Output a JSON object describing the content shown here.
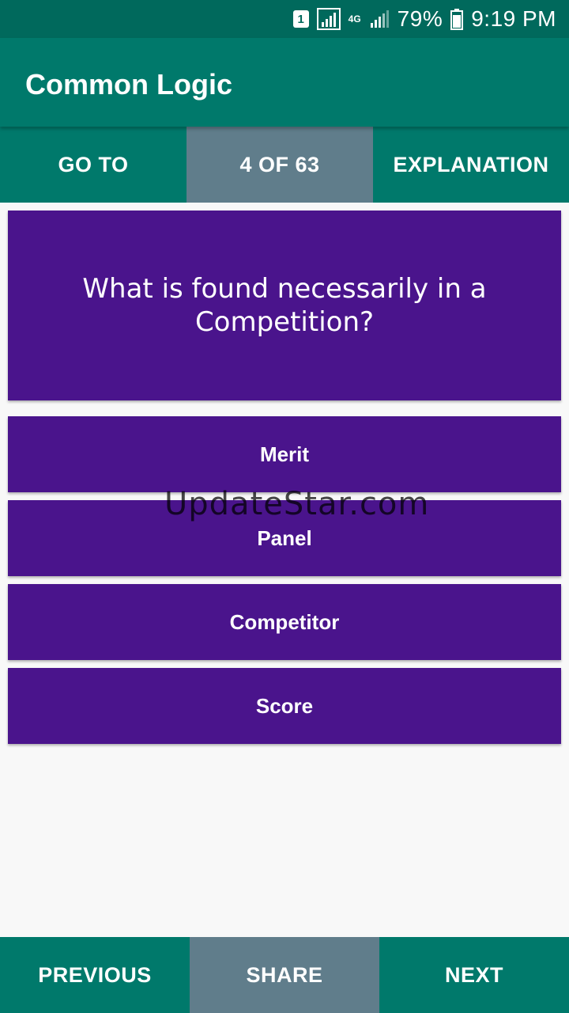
{
  "status_bar": {
    "sim_slot": "1",
    "network_type": "4G",
    "battery": "79%",
    "time": "9:19 PM",
    "icons": [
      "sim-slot-icon",
      "signal-icon",
      "network-4g-icon",
      "signal-icon",
      "battery-icon"
    ]
  },
  "app_bar": {
    "title": "Common Logic"
  },
  "top_tabs": {
    "goto_label": "GO TO",
    "counter_label": "4 OF 63",
    "explanation_label": "EXPLANATION"
  },
  "question": {
    "text": "What is found necessarily in a Competition?"
  },
  "options": [
    {
      "label": "Merit"
    },
    {
      "label": "Panel"
    },
    {
      "label": "Competitor"
    },
    {
      "label": "Score"
    }
  ],
  "watermark": "UpdateStar.com",
  "bottom_bar": {
    "previous_label": "PREVIOUS",
    "share_label": "SHARE",
    "next_label": "NEXT"
  },
  "colors": {
    "status_bar": "#00695c",
    "primary": "#00796b",
    "accent_grey": "#607d8b",
    "card_purple": "#4a148c",
    "background": "#f8f8f8"
  }
}
